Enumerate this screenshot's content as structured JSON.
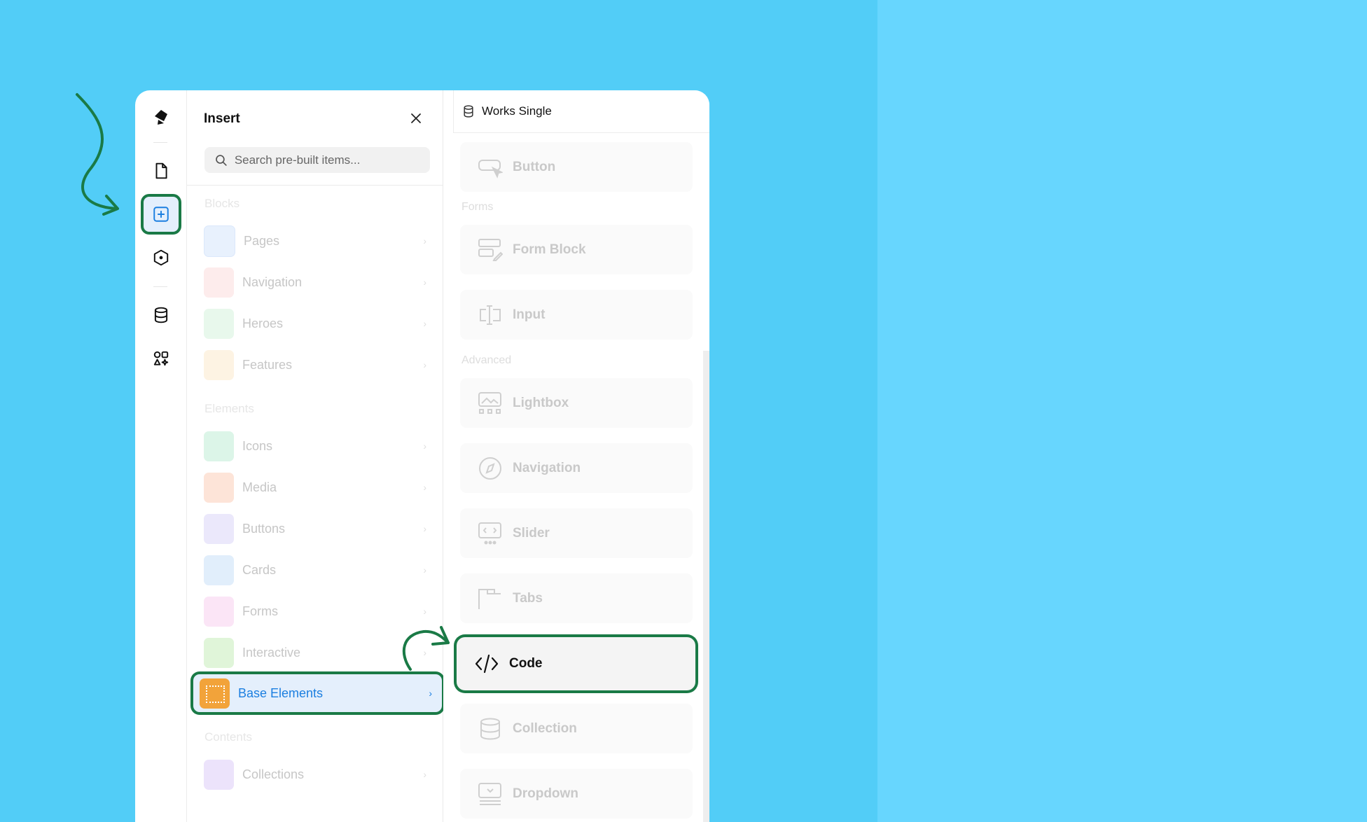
{
  "app": {
    "logo": "pen-nib-logo",
    "accent_color": "#1c7fe0",
    "highlight_color": "#1a7a46"
  },
  "rail": {
    "icons": [
      "pages-icon",
      "insert-icon",
      "components-icon",
      "database-icon",
      "apps-icon"
    ]
  },
  "insert": {
    "title": "Insert",
    "search_placeholder": "Search pre-built items...",
    "sections": {
      "blocks": "Blocks",
      "elements": "Elements",
      "contents": "Contents"
    },
    "blocks": [
      {
        "label": "Pages"
      },
      {
        "label": "Navigation"
      },
      {
        "label": "Heroes"
      },
      {
        "label": "Features"
      }
    ],
    "elements": [
      {
        "label": "Icons"
      },
      {
        "label": "Media"
      },
      {
        "label": "Buttons"
      },
      {
        "label": "Cards"
      },
      {
        "label": "Forms"
      },
      {
        "label": "Interactive"
      },
      {
        "label": "Base Elements",
        "selected": true
      }
    ],
    "contents": [
      {
        "label": "Collections"
      }
    ]
  },
  "right": {
    "header": "Works Single",
    "sections": {
      "forms": "Forms",
      "advanced": "Advanced"
    },
    "items": [
      {
        "label": "Button",
        "icon": "button-icon"
      },
      {
        "label": "Form Block",
        "icon": "form-block-icon"
      },
      {
        "label": "Input",
        "icon": "input-icon"
      },
      {
        "label": "Lightbox",
        "icon": "lightbox-icon"
      },
      {
        "label": "Navigation",
        "icon": "compass-icon"
      },
      {
        "label": "Slider",
        "icon": "slider-icon"
      },
      {
        "label": "Tabs",
        "icon": "tabs-icon"
      },
      {
        "label": "Code",
        "icon": "code-icon",
        "highlighted": true
      },
      {
        "label": "Collection",
        "icon": "collection-icon"
      },
      {
        "label": "Dropdown",
        "icon": "dropdown-icon"
      }
    ]
  }
}
